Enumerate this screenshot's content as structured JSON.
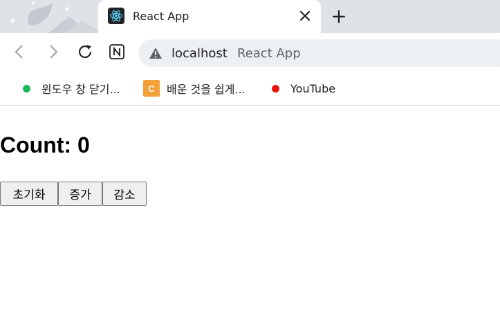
{
  "browser": {
    "tab": {
      "title": "React App",
      "favicon": "react-logo-icon",
      "close_icon": "close-icon"
    },
    "new_tab_icon": "plus-icon",
    "toolbar": {
      "back_icon": "back-arrow-icon",
      "forward_icon": "forward-arrow-icon",
      "reload_icon": "reload-icon",
      "extension_icon": "notion-icon"
    },
    "omnibox": {
      "security_icon": "warning-icon",
      "host": "localhost",
      "page_title": "React App"
    },
    "bookmarks": [
      {
        "label": "윈도우 창 닫기...",
        "icon": "green-dot-icon",
        "color": "#1db954"
      },
      {
        "label": "배운 것을 쉽게...",
        "icon": "c-letter-icon",
        "icon_letter": "C",
        "color": "#f5a13a"
      },
      {
        "label": "YouTube",
        "icon": "red-dot-icon",
        "color": "#e8160c"
      }
    ]
  },
  "app": {
    "heading": "Count: 0",
    "buttons": {
      "reset": "초기화",
      "increment": "증가",
      "decrement": "감소"
    }
  }
}
